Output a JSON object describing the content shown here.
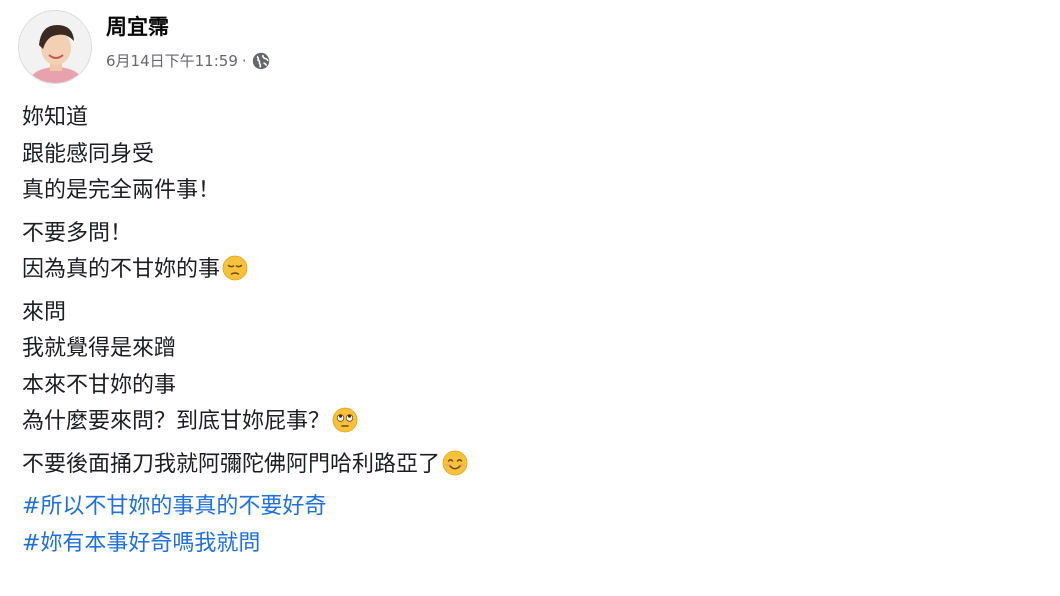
{
  "author": {
    "name": "周宜霈",
    "timestamp": "6月14日下午11:59",
    "separator": "·",
    "privacy_icon": "globe-icon"
  },
  "paragraphs": [
    [
      "妳知道",
      "跟能感同身受",
      "真的是完全兩件事！"
    ],
    [
      "不要多問！",
      "因為真的不甘妳的事"
    ],
    [
      "來問",
      "我就覺得是來蹭",
      "本來不甘妳的事",
      "為什麼要來問？到底甘妳屁事？"
    ],
    [
      "不要後面捅刀我就阿彌陀佛阿門哈利路亞了"
    ]
  ],
  "emojis": {
    "p2": "pensive-face-emoji",
    "p3": "rolling-eyes-emoji",
    "p4": "smiling-face-emoji"
  },
  "hashtags": [
    "#所以不甘妳的事真的不要好奇",
    "#妳有本事好奇嗎我就問"
  ],
  "colors": {
    "hashtag": "#216fdb",
    "text": "#1c1e21",
    "secondary": "#65676b"
  }
}
